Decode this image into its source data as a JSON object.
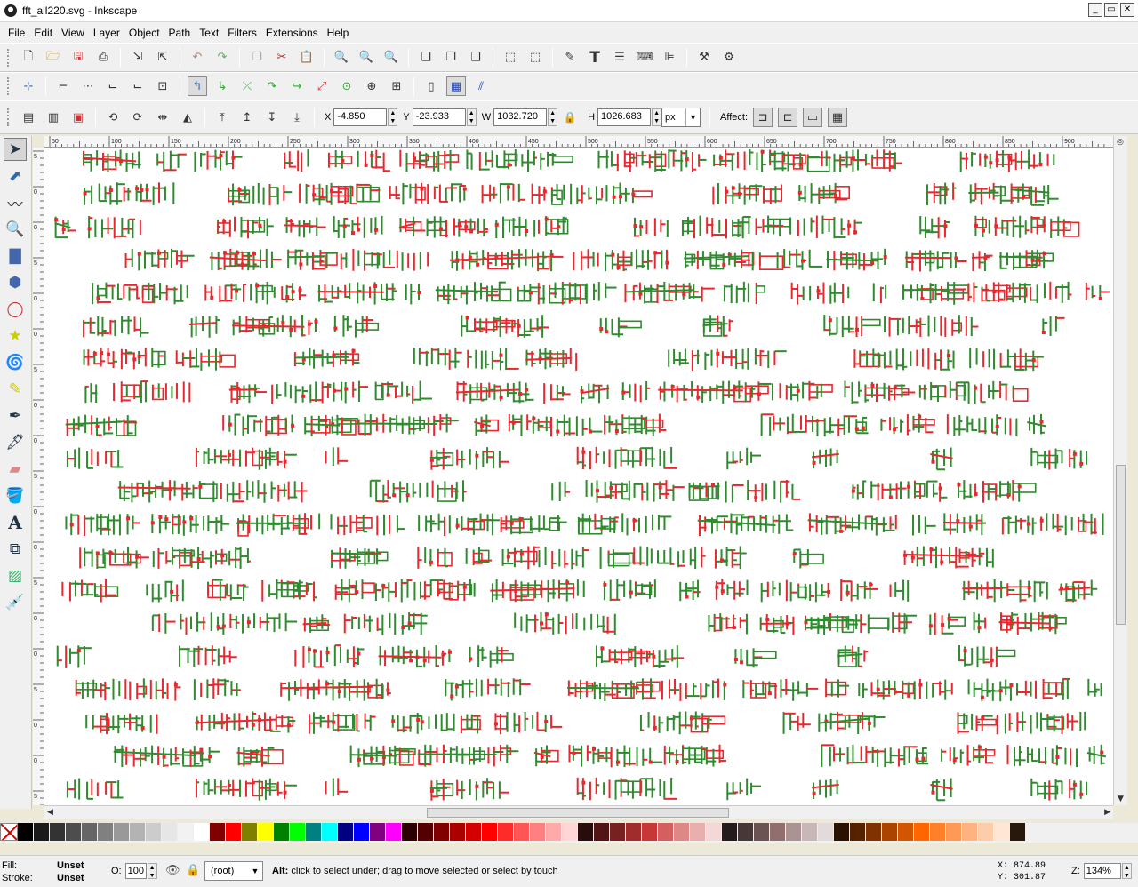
{
  "window": {
    "title": "fft_all220.svg - Inkscape",
    "buttons": [
      "_",
      "▭",
      "✕"
    ]
  },
  "menu": [
    "File",
    "Edit",
    "View",
    "Layer",
    "Object",
    "Path",
    "Text",
    "Filters",
    "Extensions",
    "Help"
  ],
  "commands_bar": [
    "new-icon",
    "open-icon",
    "save-icon",
    "print-icon",
    "import-icon",
    "export-icon",
    "undo-icon",
    "redo-icon",
    "duplicate-icon",
    "cut-icon",
    "paste-icon",
    "zoom-selection-icon",
    "zoom-drawing-icon",
    "zoom-page-icon",
    "group-icon",
    "ungroup-icon",
    "clone-icon",
    "node-editor-icon",
    "text-tool-icon",
    "layers-icon",
    "xml-editor-icon",
    "align-icon",
    "preferences-icon",
    "document-properties-icon"
  ],
  "snap_bar": [
    "snap-toggle-icon",
    "snap-bbox-icon",
    "snap-bbox-edge-icon",
    "snap-bbox-corner-icon",
    "snap-bbox-midpoint-icon",
    "snap-bbox-center-icon",
    "snap-nodes-icon",
    "snap-path-icon",
    "snap-intersection-icon",
    "snap-smooth-icon",
    "snap-midpoint-icon",
    "snap-object-center-icon",
    "snap-rotation-center-icon",
    "snap-page-icon",
    "snap-grid-icon",
    "snap-guide-icon"
  ],
  "tool_controls": {
    "x_label": "X",
    "x_value": "-4.850",
    "y_label": "Y",
    "y_value": "-23.933",
    "w_label": "W",
    "w_value": "1032.720",
    "h_label": "H",
    "h_value": "1026.683",
    "unit": "px",
    "affect_label": "Affect:"
  },
  "toolbox": [
    "selector-icon",
    "node-icon",
    "tweak-icon",
    "zoom-icon",
    "rect-icon",
    "3dbox-icon",
    "ellipse-icon",
    "star-icon",
    "spiral-icon",
    "pencil-icon",
    "pen-icon",
    "calligraphy-icon",
    "eraser-icon",
    "paint-bucket-icon",
    "text-icon",
    "connector-icon",
    "gradient-icon",
    "dropper-icon"
  ],
  "ruler": {
    "h_ticks": [
      "50",
      "100",
      "150",
      "200",
      "250",
      "300",
      "350",
      "400",
      "450",
      "500",
      "550",
      "600",
      "650",
      "700",
      "750",
      "800",
      "850",
      "900"
    ],
    "v_ticks": [
      "5",
      "0",
      "0",
      "5",
      "0",
      "0",
      "5",
      "0",
      "0",
      "5",
      "0",
      "0",
      "5",
      "0",
      "0",
      "5",
      "0",
      "0",
      "5"
    ]
  },
  "palette": [
    "#000000",
    "#1a1a1a",
    "#333333",
    "#4d4d4d",
    "#666666",
    "#808080",
    "#999999",
    "#b3b3b3",
    "#cccccc",
    "#e6e6e6",
    "#f2f2f2",
    "#ffffff",
    "#800000",
    "#ff0000",
    "#808000",
    "#ffff00",
    "#008000",
    "#00ff00",
    "#008080",
    "#00ffff",
    "#000080",
    "#0000ff",
    "#800080",
    "#ff00ff",
    "#2b0000",
    "#550000",
    "#800000",
    "#aa0000",
    "#d40000",
    "#ff0000",
    "#ff2a2a",
    "#ff5555",
    "#ff8080",
    "#ffaaaa",
    "#ffd5d5",
    "#280b0b",
    "#501616",
    "#782121",
    "#a02c2c",
    "#c83737",
    "#d35f5f",
    "#de8787",
    "#e9afaf",
    "#f4d7d7",
    "#241c1c",
    "#483737",
    "#6c5353",
    "#916f6f",
    "#ac9393",
    "#c8b7b7",
    "#e3dbdb",
    "#2b1100",
    "#552200",
    "#803300",
    "#aa4400",
    "#d45500",
    "#ff6600",
    "#ff7f2a",
    "#ff9955",
    "#ffb380",
    "#ffccaa",
    "#ffe6d5",
    "#28170b"
  ],
  "status": {
    "fill_label": "Fill:",
    "fill_value": "Unset",
    "stroke_label": "Stroke:",
    "stroke_value": "Unset",
    "opacity_label": "O:",
    "opacity_value": "100",
    "layer": "(root)",
    "message_bold": "Alt:",
    "message": " click to select under; drag to move selected or select by touch",
    "x_label": "X:",
    "x_value": "874.89",
    "y_label": "Y:",
    "y_value": "301.87",
    "zoom_label": "Z:",
    "zoom_value": "134%"
  },
  "colors": {
    "green": "#2e8b2e",
    "red": "#e8282e",
    "chrome": "#f0f0f0"
  }
}
